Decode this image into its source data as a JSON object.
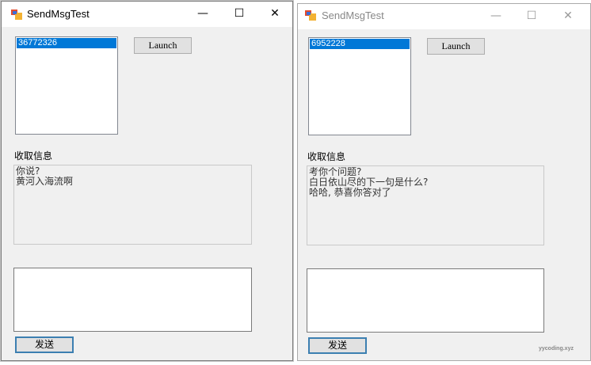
{
  "window_a": {
    "title": "SendMsgTest",
    "controls": {
      "minimize": "—",
      "maximize": "☐",
      "close": "✕"
    },
    "list": [
      "36772326"
    ],
    "launch_label": "Launch",
    "received_label": "收取信息",
    "received_lines": [
      "你说?",
      "黄河入海流啊"
    ],
    "input_value": "",
    "send_label": "发送"
  },
  "window_b": {
    "title": "SendMsgTest",
    "controls": {
      "minimize": "—",
      "maximize": "☐",
      "close": "✕"
    },
    "list": [
      "6952228"
    ],
    "launch_label": "Launch",
    "received_label": "收取信息",
    "received_lines": [
      "考你个问题?",
      "白日依山尽的下一句是什么?",
      "哈哈, 恭喜你答对了"
    ],
    "input_value": "",
    "send_label": "发送"
  },
  "watermark": "yycoding.xyz",
  "colors": {
    "selection": "#0078d7",
    "window_bg": "#f0f0f0",
    "focus_border": "#3c7fb1"
  }
}
